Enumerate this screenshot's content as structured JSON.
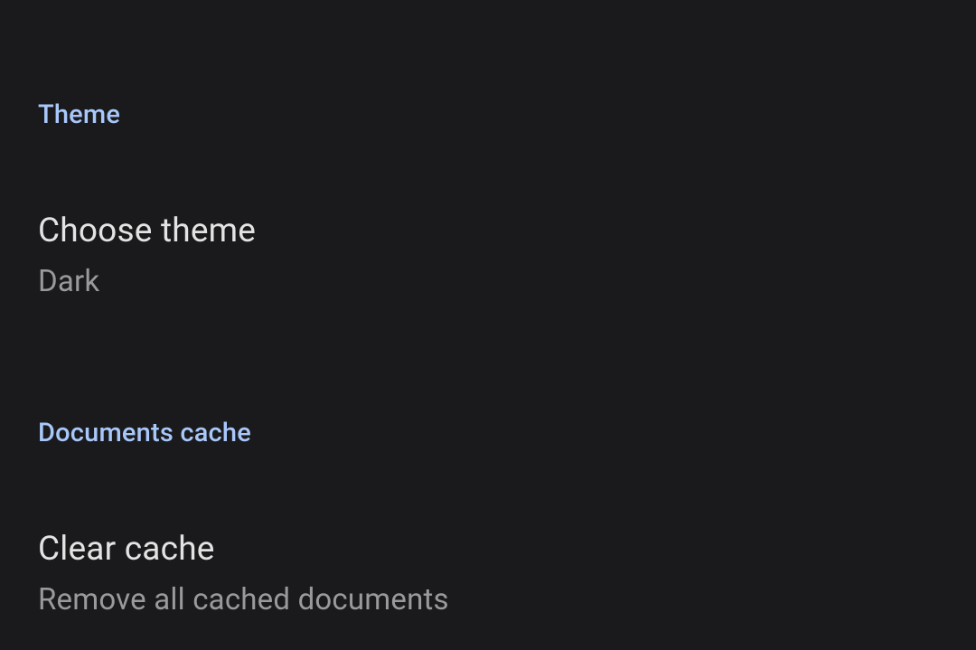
{
  "sections": {
    "theme": {
      "header": "Theme",
      "choose_theme": {
        "title": "Choose theme",
        "value": "Dark"
      }
    },
    "cache": {
      "header": "Documents cache",
      "clear_cache": {
        "title": "Clear cache",
        "subtitle": "Remove all cached documents"
      }
    }
  }
}
